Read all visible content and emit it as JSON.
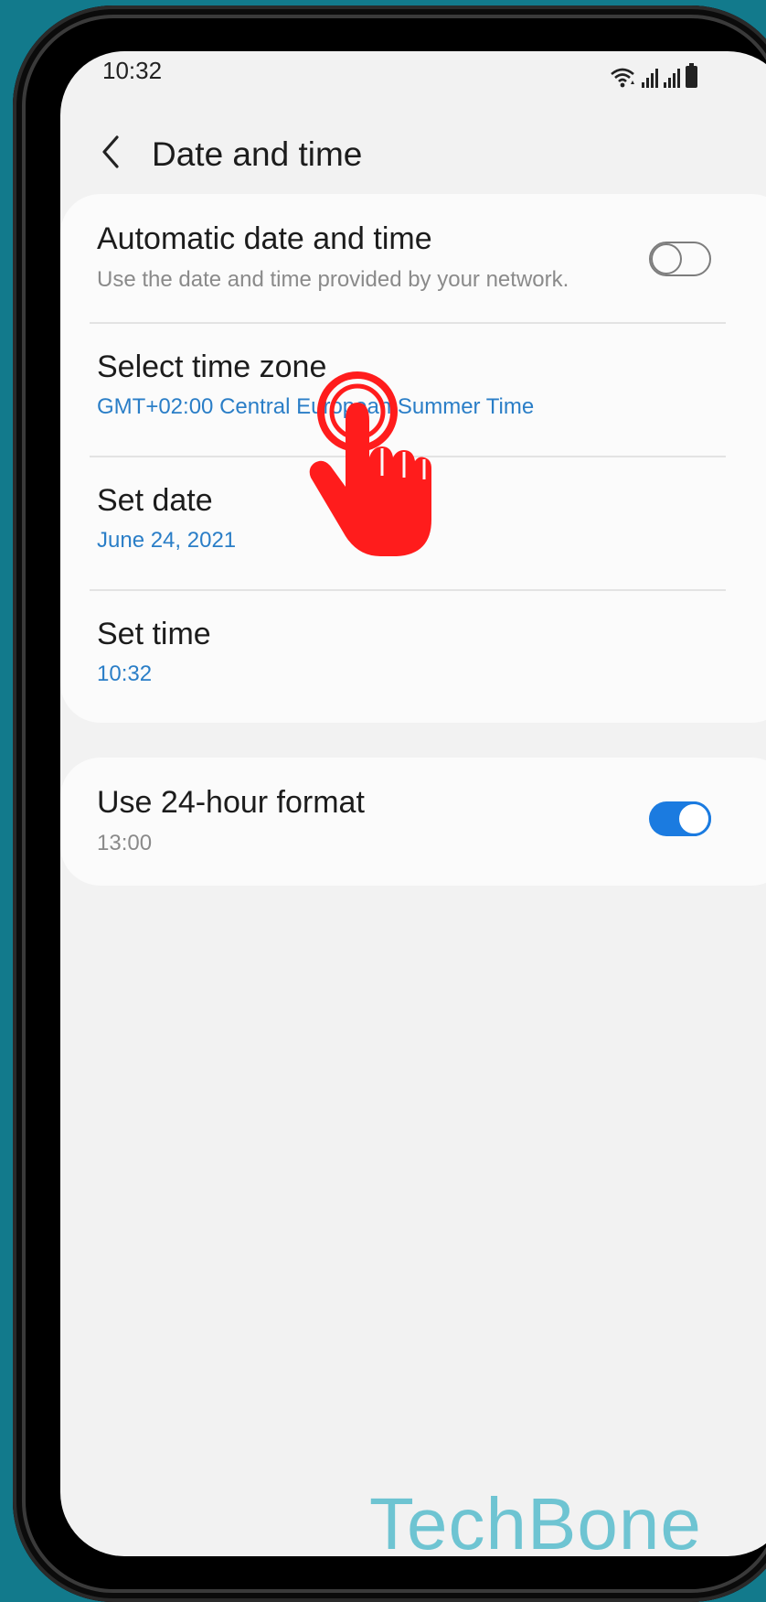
{
  "status_bar": {
    "time": "10:32",
    "icons": [
      "wifi-icon",
      "signal-icon",
      "signal-icon",
      "battery-icon"
    ]
  },
  "header": {
    "back_icon": "chevron-left-icon",
    "title": "Date and time"
  },
  "settings": {
    "automatic": {
      "title": "Automatic date and time",
      "subtitle": "Use the date and time provided by your network.",
      "toggle_on": false
    },
    "time_zone": {
      "title": "Select time zone",
      "value": "GMT+02:00 Central European Summer Time"
    },
    "set_date": {
      "title": "Set date",
      "value": "June 24, 2021"
    },
    "set_time": {
      "title": "Set time",
      "value": "10:32"
    },
    "hour_format": {
      "title": "Use 24-hour format",
      "value": "13:00",
      "toggle_on": true
    }
  },
  "colors": {
    "accent": "#1b7be0",
    "value_text": "#2a7ec7",
    "background": "#127a8c",
    "tap_indicator": "#ff1c1c"
  },
  "overlay": {
    "tap_indicator_icon": "tap-hand-icon",
    "watermark": "TechBone"
  }
}
